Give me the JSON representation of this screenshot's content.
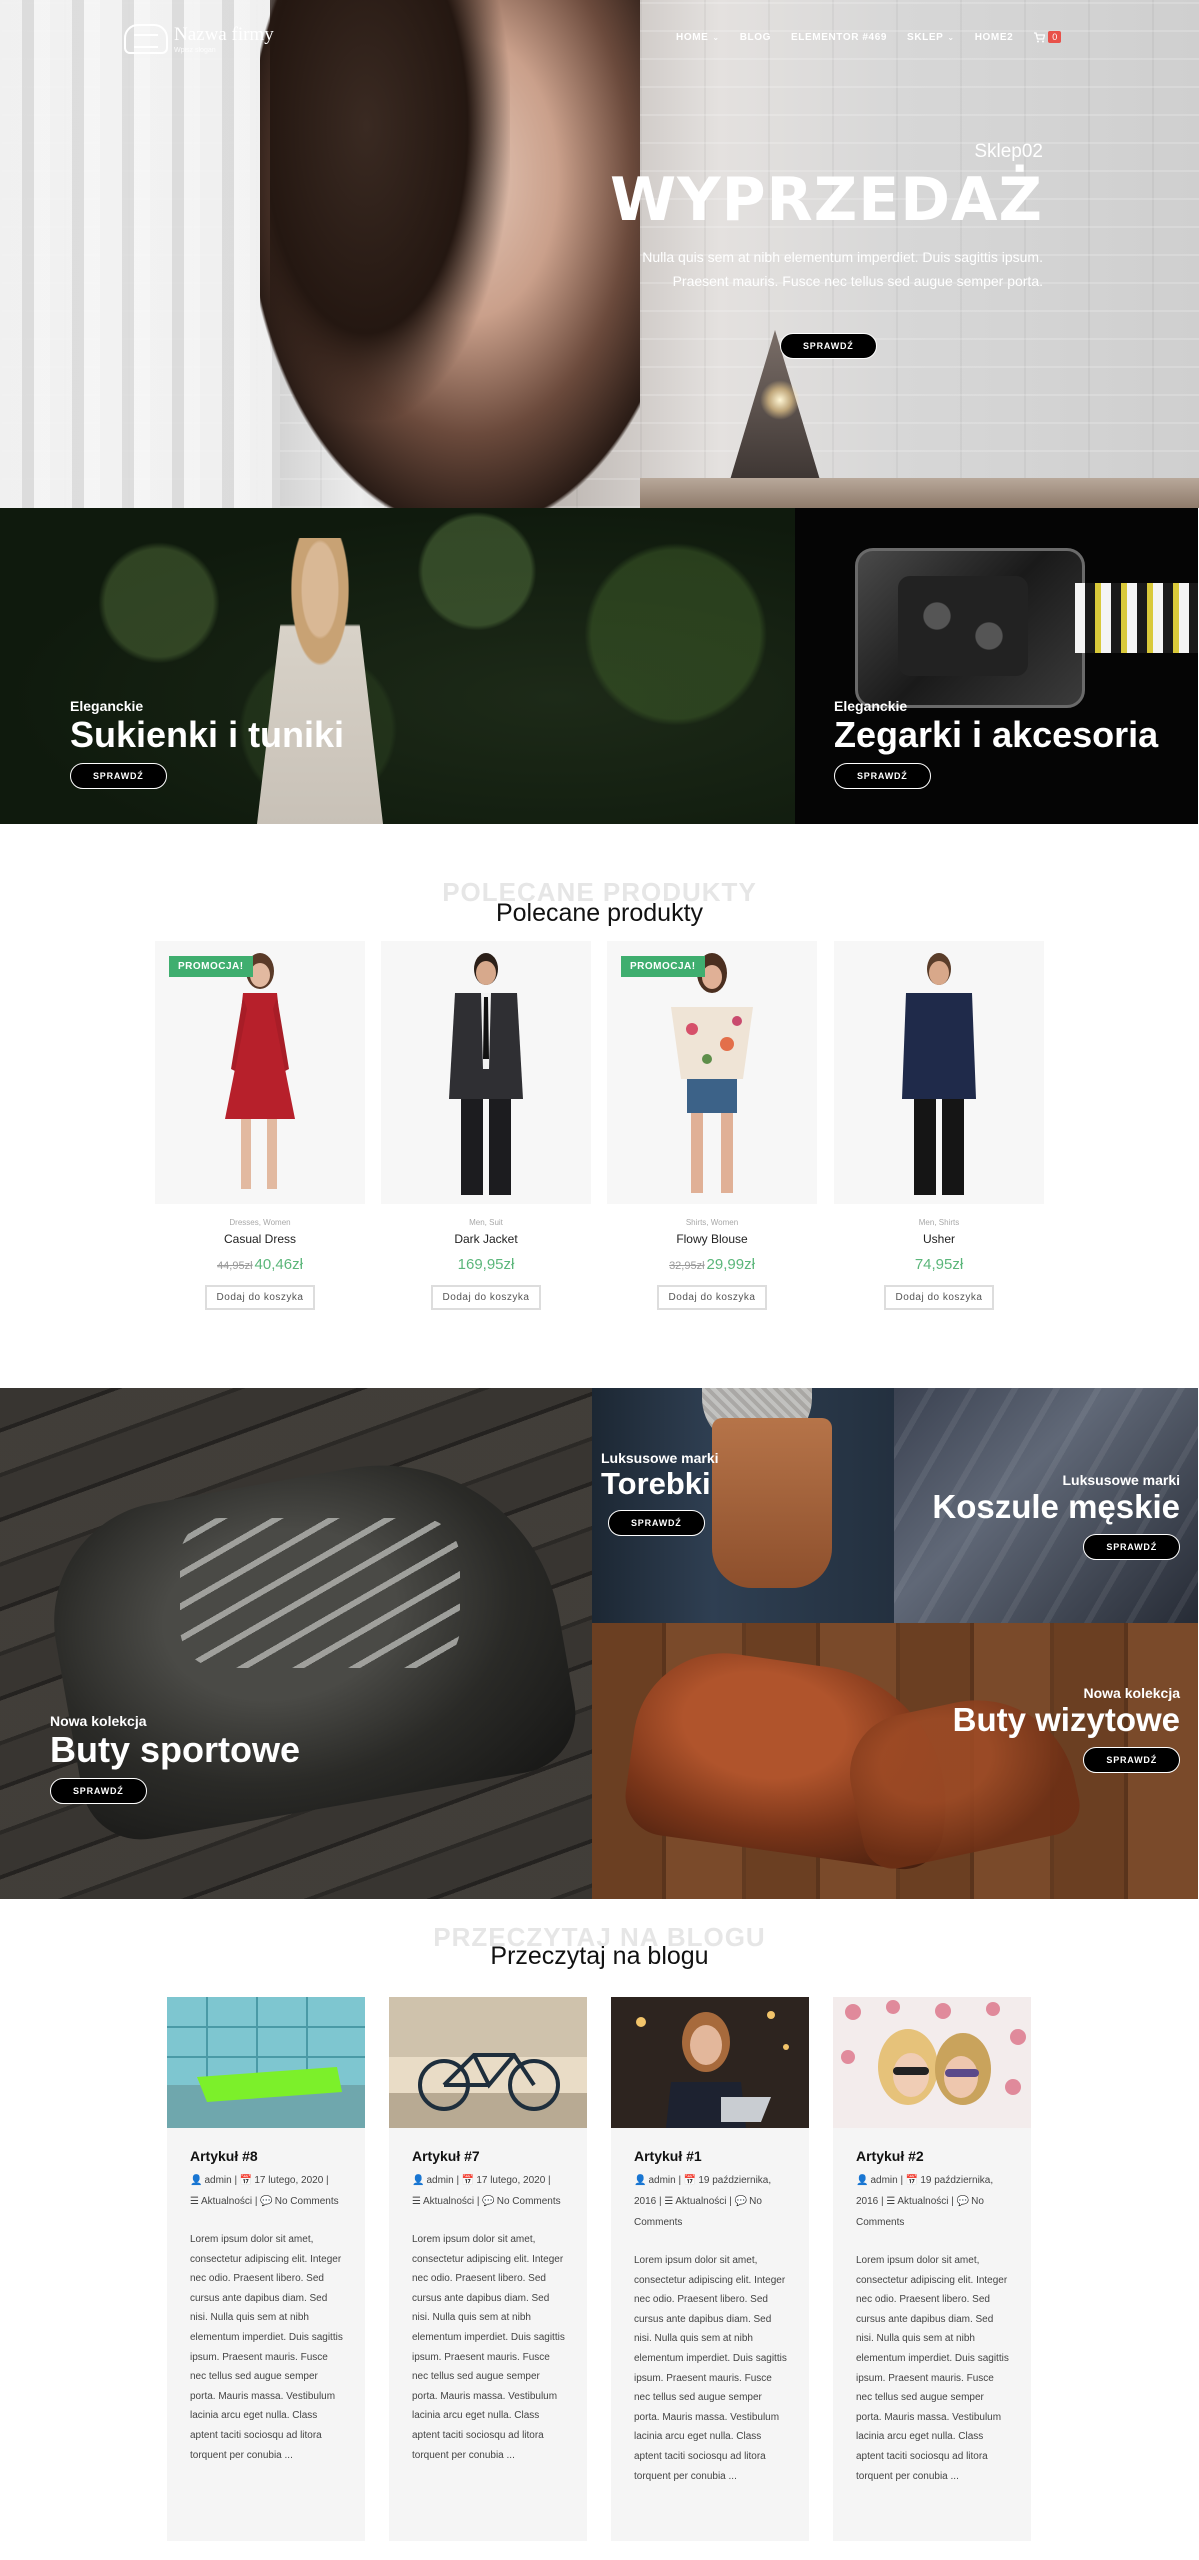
{
  "header": {
    "logo": {
      "name": "Nazwa firmy",
      "tagline": "Wpisz slogan"
    },
    "nav": [
      {
        "label": "HOME",
        "has_dropdown": true
      },
      {
        "label": "BLOG",
        "has_dropdown": false
      },
      {
        "label": "ELEMENTOR #469",
        "has_dropdown": false
      },
      {
        "label": "SKLEP",
        "has_dropdown": true
      },
      {
        "label": "HOME2",
        "has_dropdown": false
      }
    ],
    "cart": {
      "icon": "cart-icon",
      "count": "0"
    },
    "chevron": "⌄"
  },
  "hero": {
    "subtitle": "Sklep02",
    "title": "WYPRZEDAŻ",
    "description": "Nulla quis sem at nibh elementum imperdiet. Duis sagittis ipsum. Praesent mauris. Fusce nec tellus sed augue semper porta.",
    "button": "SPRAWDŹ"
  },
  "banners": {
    "dresses": {
      "subtitle": "Eleganckie",
      "title": "Sukienki i tuniki",
      "button": "SPRAWDŹ"
    },
    "watches": {
      "subtitle": "Eleganckie",
      "title": "Zegarki i akcesoria",
      "button": "SPRAWDŹ"
    },
    "sport_shoes": {
      "subtitle": "Nowa kolekcja",
      "title": "Buty sportowe",
      "button": "SPRAWDŹ"
    },
    "bags": {
      "subtitle": "Luksusowe marki",
      "title": "Torebki",
      "button": "SPRAWDŹ"
    },
    "shirts": {
      "subtitle": "Luksusowe marki",
      "title": "Koszule męskie",
      "button": "SPRAWDŹ"
    },
    "dress_shoes": {
      "subtitle": "Nowa kolekcja",
      "title": "Buty wizytowe",
      "button": "SPRAWDŹ"
    }
  },
  "featured": {
    "bg_title": "POLECANE PRODUKTY",
    "title": "Polecane produkty",
    "products": [
      {
        "badge": "PROMOCJA!",
        "cats": "Dresses, Women",
        "name": "Casual Dress",
        "old_price": "44,95zł",
        "price": "40,46zł",
        "button": "Dodaj do koszyka"
      },
      {
        "badge": "",
        "cats": "Men, Suit",
        "name": "Dark Jacket",
        "old_price": "",
        "price": "169,95zł",
        "button": "Dodaj do koszyka"
      },
      {
        "badge": "PROMOCJA!",
        "cats": "Shirts, Women",
        "name": "Flowy Blouse",
        "old_price": "32,95zł",
        "price": "29,99zł",
        "button": "Dodaj do koszyka"
      },
      {
        "badge": "",
        "cats": "Men, Shirts",
        "name": "Usher",
        "old_price": "",
        "price": "74,95zł",
        "button": "Dodaj do koszyka"
      }
    ]
  },
  "blog": {
    "bg_title": "PRZECZYTAJ NA BLOGU",
    "title": "Przeczytaj na blogu",
    "posts": [
      {
        "title": "Artykuł #8",
        "author": "admin",
        "date": "17 lutego, 2020",
        "category": "Aktualności",
        "comments": "No Comments",
        "excerpt": "Lorem ipsum dolor sit amet, consectetur adipiscing elit. Integer nec odio. Praesent libero. Sed cursus ante dapibus diam. Sed nisi. Nulla quis sem at nibh elementum imperdiet. Duis sagittis ipsum. Praesent mauris. Fusce nec tellus sed augue semper porta. Mauris massa. Vestibulum lacinia arcu eget nulla. Class aptent taciti sociosqu ad litora torquent per conubia ..."
      },
      {
        "title": "Artykuł #7",
        "author": "admin",
        "date": "17 lutego, 2020",
        "category": "Aktualności",
        "comments": "No Comments",
        "excerpt": "Lorem ipsum dolor sit amet, consectetur adipiscing elit. Integer nec odio. Praesent libero. Sed cursus ante dapibus diam. Sed nisi. Nulla quis sem at nibh elementum imperdiet. Duis sagittis ipsum. Praesent mauris. Fusce nec tellus sed augue semper porta. Mauris massa. Vestibulum lacinia arcu eget nulla. Class aptent taciti sociosqu ad litora torquent per conubia ..."
      },
      {
        "title": "Artykuł #1",
        "author": "admin",
        "date": "19 października, 2016",
        "category": "Aktualności",
        "comments": "No Comments",
        "excerpt": "Lorem ipsum dolor sit amet, consectetur adipiscing elit. Integer nec odio. Praesent libero. Sed cursus ante dapibus diam. Sed nisi. Nulla quis sem at nibh elementum imperdiet. Duis sagittis ipsum. Praesent mauris. Fusce nec tellus sed augue semper porta. Mauris massa. Vestibulum lacinia arcu eget nulla. Class aptent taciti sociosqu ad litora torquent per conubia ..."
      },
      {
        "title": "Artykuł #2",
        "author": "admin",
        "date": "19 października, 2016",
        "category": "Aktualności",
        "comments": "No Comments",
        "excerpt": "Lorem ipsum dolor sit amet, consectetur adipiscing elit. Integer nec odio. Praesent libero. Sed cursus ante dapibus diam. Sed nisi. Nulla quis sem at nibh elementum imperdiet. Duis sagittis ipsum. Praesent mauris. Fusce nec tellus sed augue semper porta. Mauris massa. Vestibulum lacinia arcu eget nulla. Class aptent taciti sociosqu ad litora torquent per conubia ..."
      }
    ]
  },
  "colors": {
    "promo_badge": "#3fae6f",
    "price": "#5bb67a",
    "cart_badge": "#e8514a",
    "button_bg": "#000000"
  }
}
